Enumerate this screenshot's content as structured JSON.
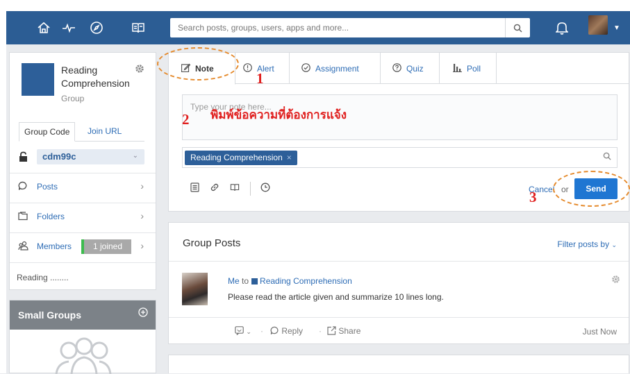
{
  "nav": {
    "icons": [
      "home-icon",
      "pulse-icon",
      "compass-icon",
      "book-icon"
    ],
    "search_placeholder": "Search posts, groups, users, apps and more..."
  },
  "group": {
    "name": "Reading Comprehension",
    "type": "Group",
    "tab_code": "Group Code",
    "tab_join": "Join URL",
    "code": "cdm99c",
    "menu": {
      "posts": "Posts",
      "folders": "Folders",
      "members": "Members",
      "joined": "1 joined"
    },
    "description": "Reading ........"
  },
  "small_groups": {
    "title": "Small Groups"
  },
  "composer": {
    "tabs": [
      "Note",
      "Alert",
      "Assignment",
      "Quiz",
      "Poll"
    ],
    "placeholder": "Type your note here...",
    "recipient": "Reading Comprehension",
    "cancel": "Cancel",
    "or": "or",
    "send": "Send"
  },
  "annotations": {
    "n1": "1",
    "n2": "2",
    "n3": "3",
    "thai": "พิมพ์ข้อความที่ต้องการแจ้ง",
    "color": "#e0201f",
    "ellipse_color": "#e58a2c"
  },
  "posts": {
    "title": "Group Posts",
    "filter": "Filter posts by",
    "post": {
      "author": "Me",
      "to": "to",
      "group": "Reading Comprehension",
      "body": "Please read the article given and summarize 10 lines long.",
      "reply": "Reply",
      "share": "Share",
      "time": "Just Now"
    }
  },
  "colors": {
    "nav": "#2c5d94",
    "accent": "#1f76d2",
    "joined": "#3dbb4e"
  }
}
